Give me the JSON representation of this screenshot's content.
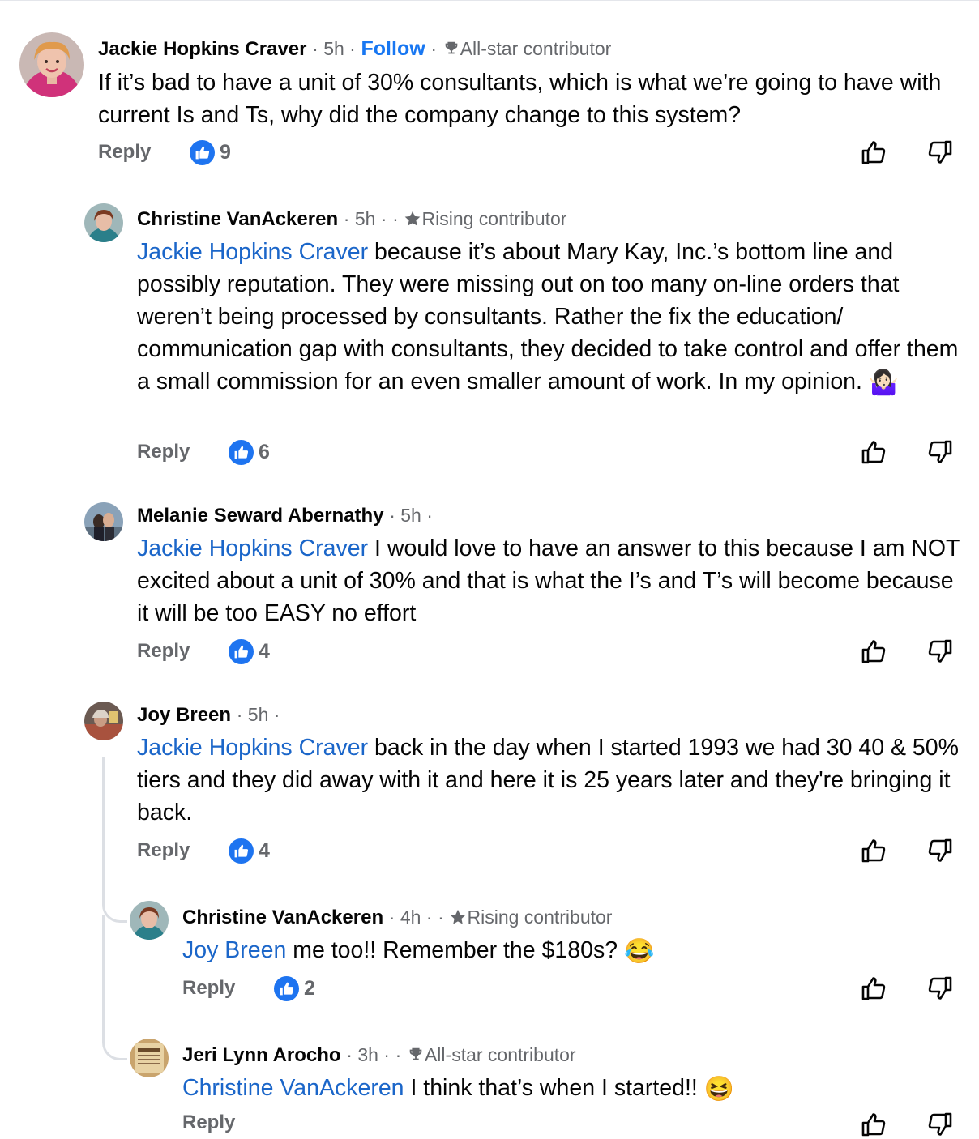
{
  "comments": [
    {
      "name": "Jackie Hopkins Craver",
      "time": "· 5h ·",
      "follow": "Follow",
      "sep": "·",
      "badge": "All-star contributor",
      "mention": "",
      "text": "If it’s bad to have a unit of 30% consultants, which is what we’re going to have with current Is and Ts, why did the company change to this system?",
      "emoji": "",
      "reply": "Reply",
      "likes": "9"
    },
    {
      "name": "Christine VanAckeren",
      "time": "· 5h ·",
      "sep": "·",
      "badge": "Rising contributor",
      "mention": "Jackie Hopkins Craver",
      "text": " because it’s about Mary Kay, Inc.’s bottom line and possibly reputation. They were missing out on too many on-line orders that weren’t being processed by consultants. Rather the fix the education/ communication gap with consultants, they decided to take control and offer them a small commission for an even smaller amount of work. In my opinion. ",
      "emoji": "🤷🏻‍♀️",
      "reply": "Reply",
      "likes": "6"
    },
    {
      "name": "Melanie Seward Abernathy",
      "time": "· 5h ·",
      "mention": "Jackie Hopkins Craver",
      "text": " I would love to have an answer to this because I am NOT excited about a unit of 30% and that is what the I’s and T’s will become because it will be too EASY no effort",
      "reply": "Reply",
      "likes": "4"
    },
    {
      "name": "Joy Breen",
      "time": "· 5h ·",
      "mention": "Jackie Hopkins Craver",
      "text": " back in the day when I started 1993 we had 30 40 & 50% tiers and they did away with it and here it is 25 years later and they're bringing it back.",
      "reply": "Reply",
      "likes": "4"
    },
    {
      "name": "Christine VanAckeren",
      "time": "· 4h ·",
      "sep": "·",
      "badge": "Rising contributor",
      "mention": "Joy Breen",
      "text": " me too!! Remember the $180s? ",
      "emoji": "😂",
      "reply": "Reply",
      "likes": "2"
    },
    {
      "name": "Jeri Lynn Arocho",
      "time": "· 3h ·",
      "sep": "·",
      "badge": "All-star contributor",
      "mention": "Christine VanAckeren",
      "text": " I think that’s when I started!! ",
      "emoji": "😆",
      "reply": "Reply"
    }
  ],
  "icons": {
    "like_badge": "thumbs-up-icon",
    "upvote": "thumbs-up-outline-icon",
    "downvote": "thumbs-down-outline-icon",
    "all_star": "trophy-icon",
    "rising": "star-icon"
  },
  "colors": {
    "link": "#1b66c9",
    "follow": "#1877f2",
    "like": "#1e74f0",
    "meta": "#65676b"
  }
}
